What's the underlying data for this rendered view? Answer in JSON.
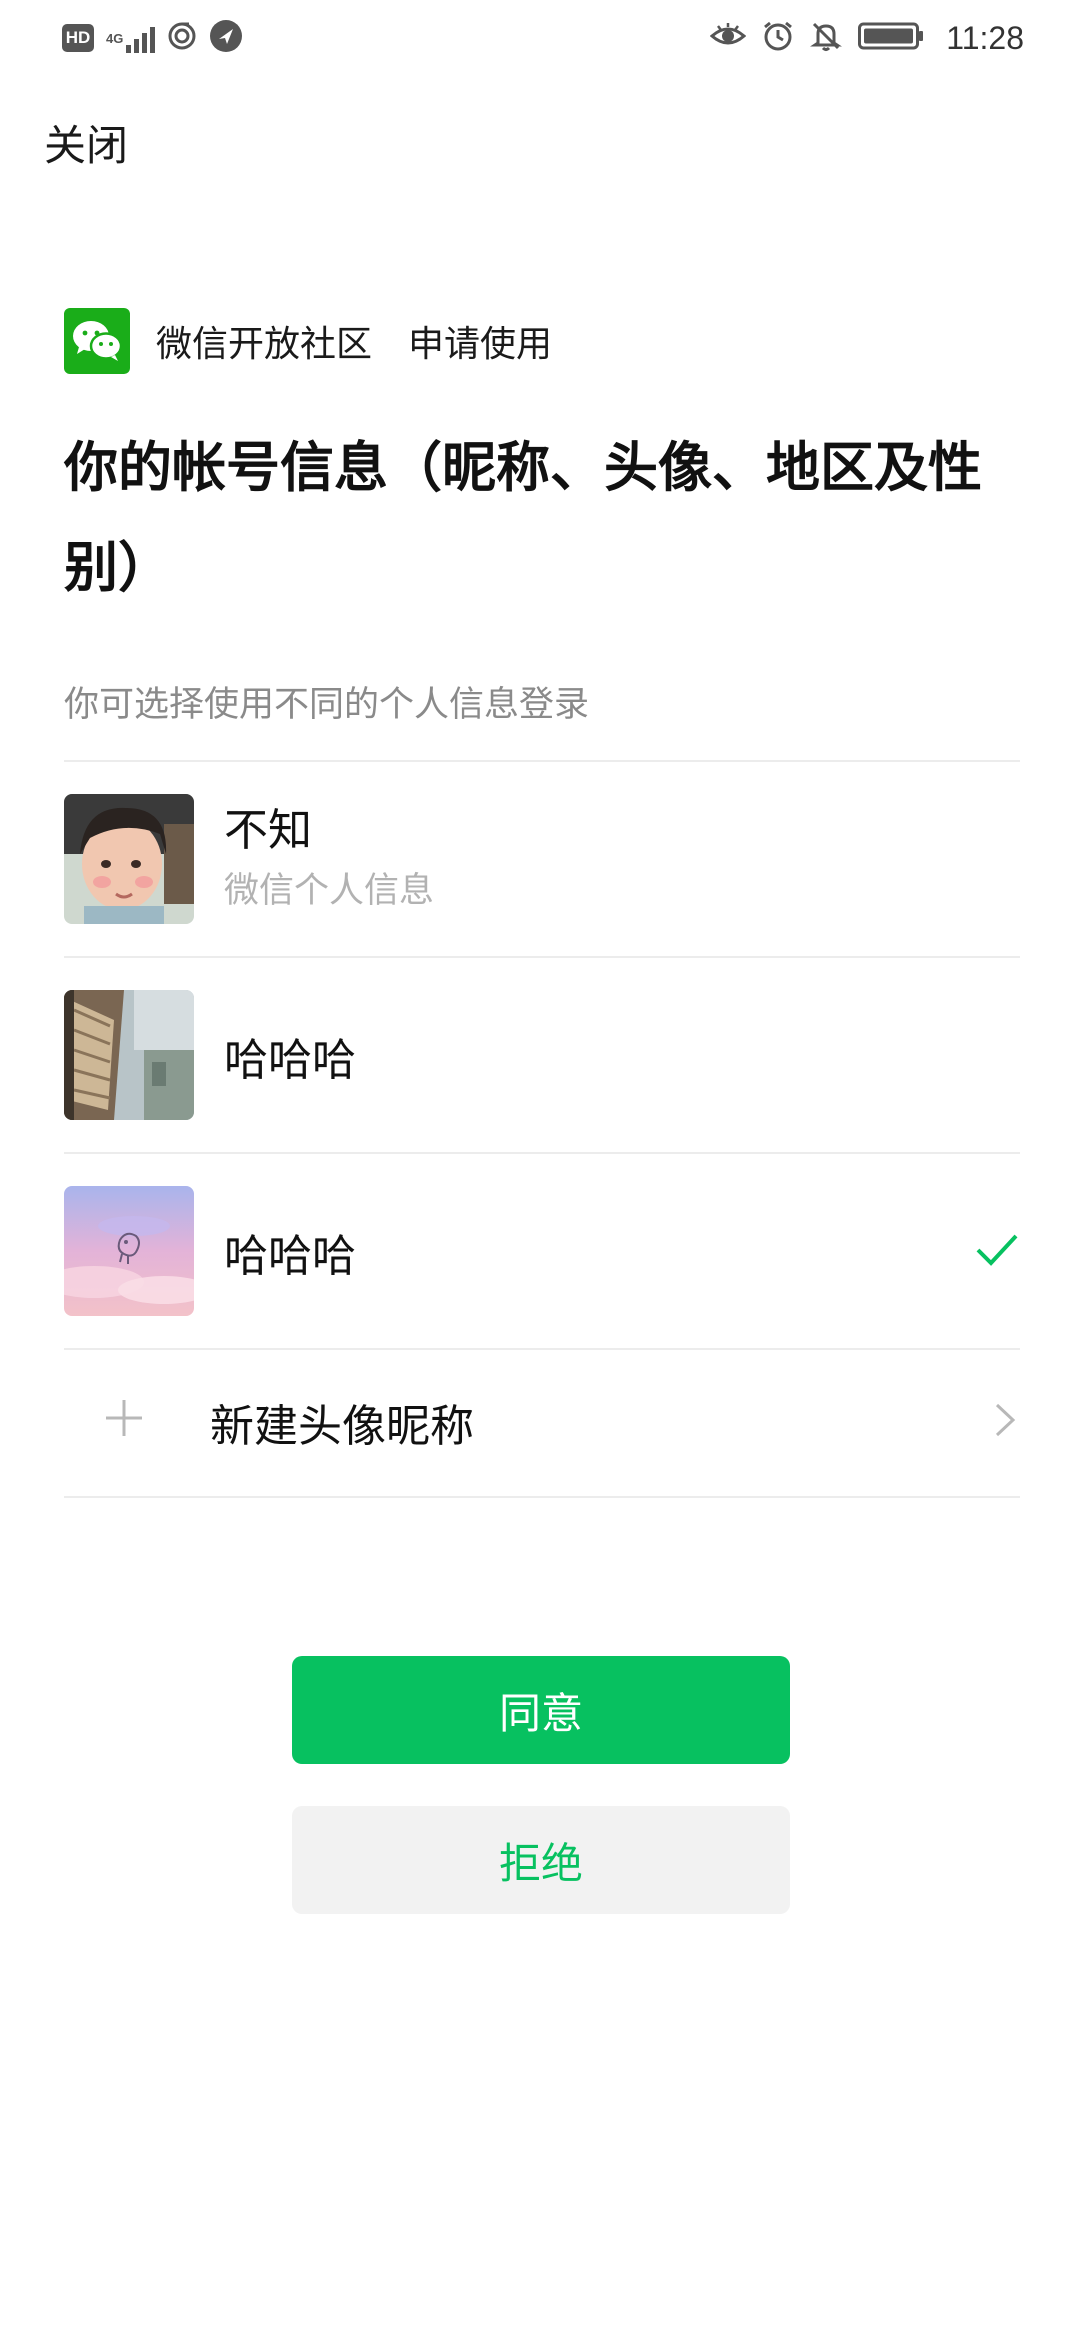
{
  "status_bar": {
    "left_badge": "HD",
    "network_label": "4G",
    "time": "11:28"
  },
  "header": {
    "close_label": "关闭"
  },
  "app": {
    "name": "微信开放社区",
    "action": "申请使用"
  },
  "title": "你的帐号信息（昵称、头像、地区及性别）",
  "hint": "你可选择使用不同的个人信息登录",
  "profiles": [
    {
      "name": "不知",
      "subtitle": "微信个人信息",
      "selected": false
    },
    {
      "name": "哈哈哈",
      "subtitle": "",
      "selected": false
    },
    {
      "name": "哈哈哈",
      "subtitle": "",
      "selected": true
    }
  ],
  "new_profile_label": "新建头像昵称",
  "buttons": {
    "agree": "同意",
    "reject": "拒绝"
  },
  "colors": {
    "accent": "#07c160",
    "logo": "#1aad19",
    "hint": "#8a8a8a"
  },
  "icons": [
    "hd-icon",
    "signal-icon",
    "hotspot-icon",
    "navigation-icon",
    "eye-icon",
    "alarm-icon",
    "bell-off-icon",
    "battery-icon",
    "wechat-logo-icon",
    "check-icon",
    "plus-icon",
    "chevron-right-icon"
  ]
}
